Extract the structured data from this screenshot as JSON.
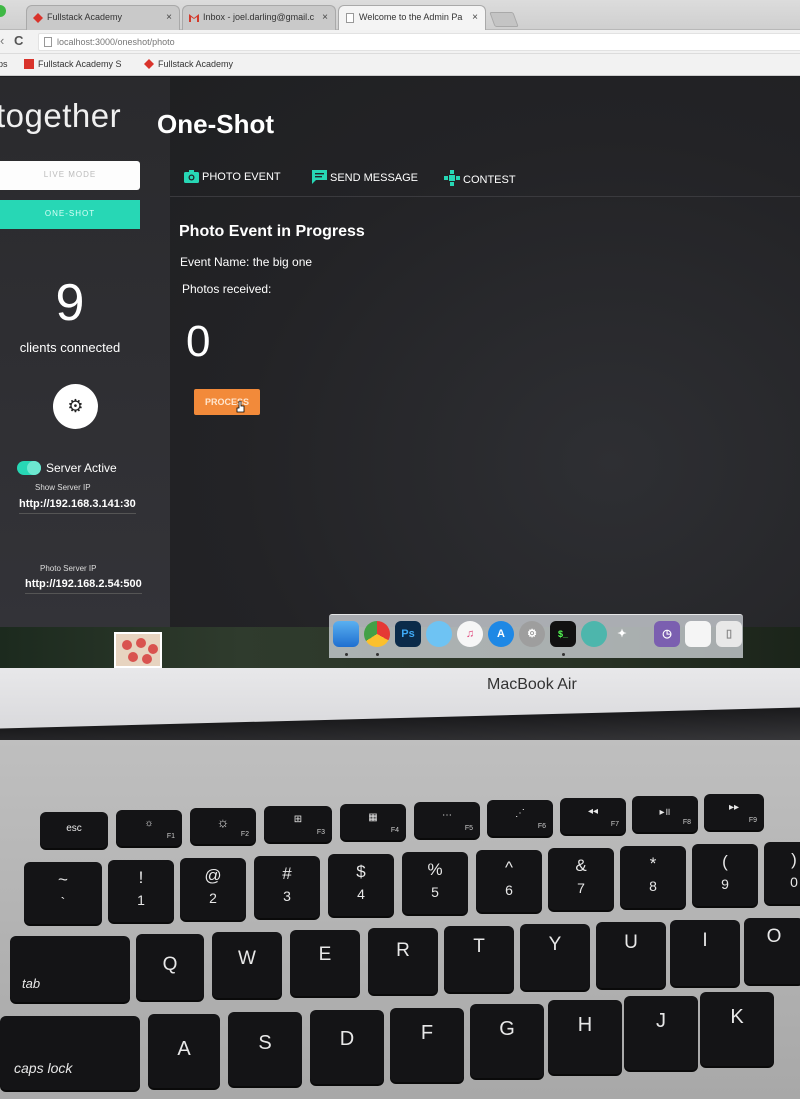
{
  "browser": {
    "tabs": [
      {
        "title": "Fullstack Academy",
        "close": "×"
      },
      {
        "title": "Inbox - joel.darling@gmail.c",
        "close": "×"
      },
      {
        "title": "Welcome to the Admin Pa",
        "close": "×"
      }
    ],
    "url": "localhost:3000/oneshot/photo",
    "bookmarks": [
      "ps",
      "Fullstack Academy S",
      "Fullstack Academy"
    ]
  },
  "sidebar": {
    "brand": "together",
    "live_mode_label": "LIVE MODE",
    "one_shot_label": "ONE-SHOT",
    "client_count": "9",
    "client_count_label": "clients connected",
    "server_toggle_label": "Server Active",
    "show_server_ip_caption": "Show Server IP",
    "server_ip": "http://192.168.3.141:30",
    "photo_server_ip_caption": "Photo Server IP",
    "photo_server_ip": "http://192.168.2.54:500"
  },
  "main": {
    "title": "One-Shot",
    "tabs": [
      {
        "label": "PHOTO EVENT",
        "icon": "camera-icon"
      },
      {
        "label": "SEND MESSAGE",
        "icon": "message-icon"
      },
      {
        "label": "CONTEST",
        "icon": "gamepad-icon"
      }
    ],
    "section_title": "Photo Event in Progress",
    "event_name": "Event Name: the big one",
    "photos_received_label": "Photos received:",
    "photos_received_count": "0",
    "process_button": "PROCESS"
  },
  "laptop": {
    "model": "MacBook Air"
  },
  "keyboard": {
    "fn_row": [
      {
        "label": "esc"
      },
      {
        "label": "☼",
        "fn": "F1"
      },
      {
        "label": "☼",
        "fn": "F2"
      },
      {
        "label": "⊞",
        "fn": "F3"
      },
      {
        "label": "▦",
        "fn": "F4"
      },
      {
        "label": "⋯",
        "fn": "F5"
      },
      {
        "label": "⋰",
        "fn": "F6"
      },
      {
        "label": "◂◂",
        "fn": "F7"
      },
      {
        "label": "▸॥",
        "fn": "F8"
      },
      {
        "label": "▸▸",
        "fn": "F9"
      }
    ],
    "number_row": [
      {
        "top": "~",
        "bottom": "`"
      },
      {
        "top": "!",
        "bottom": "1"
      },
      {
        "top": "@",
        "bottom": "2"
      },
      {
        "top": "#",
        "bottom": "3"
      },
      {
        "top": "$",
        "bottom": "4"
      },
      {
        "top": "%",
        "bottom": "5"
      },
      {
        "top": "^",
        "bottom": "6"
      },
      {
        "top": "&",
        "bottom": "7"
      },
      {
        "top": "*",
        "bottom": "8"
      },
      {
        "top": "(",
        "bottom": "9"
      },
      {
        "top": ")",
        "bottom": "0"
      }
    ],
    "qwerty_row": [
      "tab",
      "Q",
      "W",
      "E",
      "R",
      "T",
      "Y",
      "U",
      "I",
      "O"
    ],
    "home_row": [
      "caps lock",
      "A",
      "S",
      "D",
      "F",
      "G",
      "H",
      "J",
      "K"
    ]
  },
  "colors": {
    "accent_teal": "#27d7b5",
    "process_orange": "#f28a3a",
    "app_background": "#232326"
  }
}
